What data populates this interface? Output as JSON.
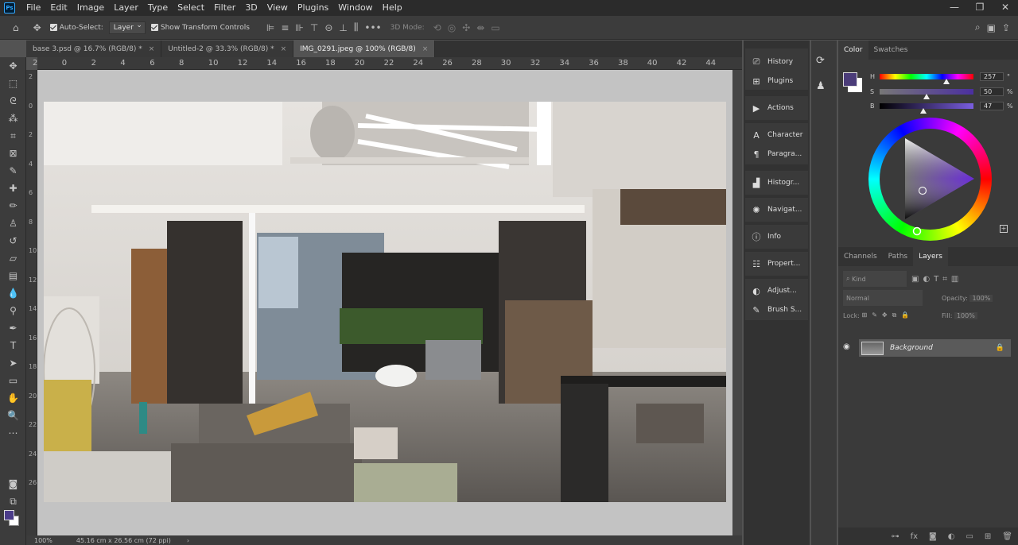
{
  "menubar": {
    "logo": "Ps",
    "items": [
      "File",
      "Edit",
      "Image",
      "Layer",
      "Type",
      "Select",
      "Filter",
      "3D",
      "View",
      "Plugins",
      "Window",
      "Help"
    ],
    "win": [
      "—",
      "❐",
      "✕"
    ]
  },
  "options": {
    "auto_select_label": "Auto-Select:",
    "auto_select_target": "Layer",
    "transform_label": "Show Transform Controls",
    "mode_3d": "3D Mode:"
  },
  "tabs": [
    {
      "label": "base 3.psd @ 16.7% (RGB/8) *"
    },
    {
      "label": "Untitled-2 @ 33.3% (RGB/8) *"
    },
    {
      "label": "IMG_0291.jpeg @ 100% (RGB/8)"
    }
  ],
  "tab_close": "×",
  "ruler_top": [
    "2",
    "0",
    "2",
    "4",
    "6",
    "8",
    "10",
    "12",
    "14",
    "16",
    "18",
    "20",
    "22",
    "24",
    "26",
    "28",
    "30",
    "32",
    "34",
    "36",
    "38",
    "40",
    "42",
    "44"
  ],
  "ruler_left": [
    "2",
    "0",
    "2",
    "4",
    "6",
    "8",
    "10",
    "12",
    "14",
    "16",
    "18",
    "20",
    "22",
    "24",
    "26"
  ],
  "status": {
    "zoom": "100%",
    "doc": "45.16 cm x 26.56 cm (72 ppi)",
    "arrow": "›"
  },
  "collapsed_panels": [
    {
      "label": "History",
      "icon": "history-icon"
    },
    {
      "label": "Plugins",
      "icon": "plugins-icon"
    },
    {
      "label": "Actions",
      "icon": "play-icon"
    },
    {
      "label": "Character",
      "icon": "character-icon"
    },
    {
      "label": "Paragra...",
      "icon": "paragraph-icon"
    },
    {
      "label": "Histogr...",
      "icon": "histogram-icon"
    },
    {
      "label": "Navigat...",
      "icon": "navigator-icon"
    },
    {
      "label": "Info",
      "icon": "info-icon"
    },
    {
      "label": "Propert...",
      "icon": "properties-icon"
    },
    {
      "label": "Adjust...",
      "icon": "adjust-icon"
    },
    {
      "label": "Brush S...",
      "icon": "brush-settings-icon"
    }
  ],
  "color_panel": {
    "tabs": [
      "Color",
      "Swatches"
    ],
    "h_label": "H",
    "h_value": "257",
    "h_unit": "°",
    "s_label": "S",
    "s_value": "50",
    "s_unit": "%",
    "b_label": "B",
    "b_value": "47",
    "b_unit": "%",
    "h_frac": 0.71,
    "s_frac": 0.5,
    "b_frac": 0.47,
    "foreground": "#4b3c79",
    "background": "#ffffff"
  },
  "layers_panel": {
    "tabs": [
      "Channels",
      "Paths",
      "Layers"
    ],
    "kind_placeholder": "Kind",
    "blend": "Normal",
    "opacity_label": "Opacity:",
    "opacity_value": "100%",
    "lock_label": "Lock:",
    "fill_label": "Fill:",
    "fill_value": "100%",
    "layer_name": "Background"
  }
}
